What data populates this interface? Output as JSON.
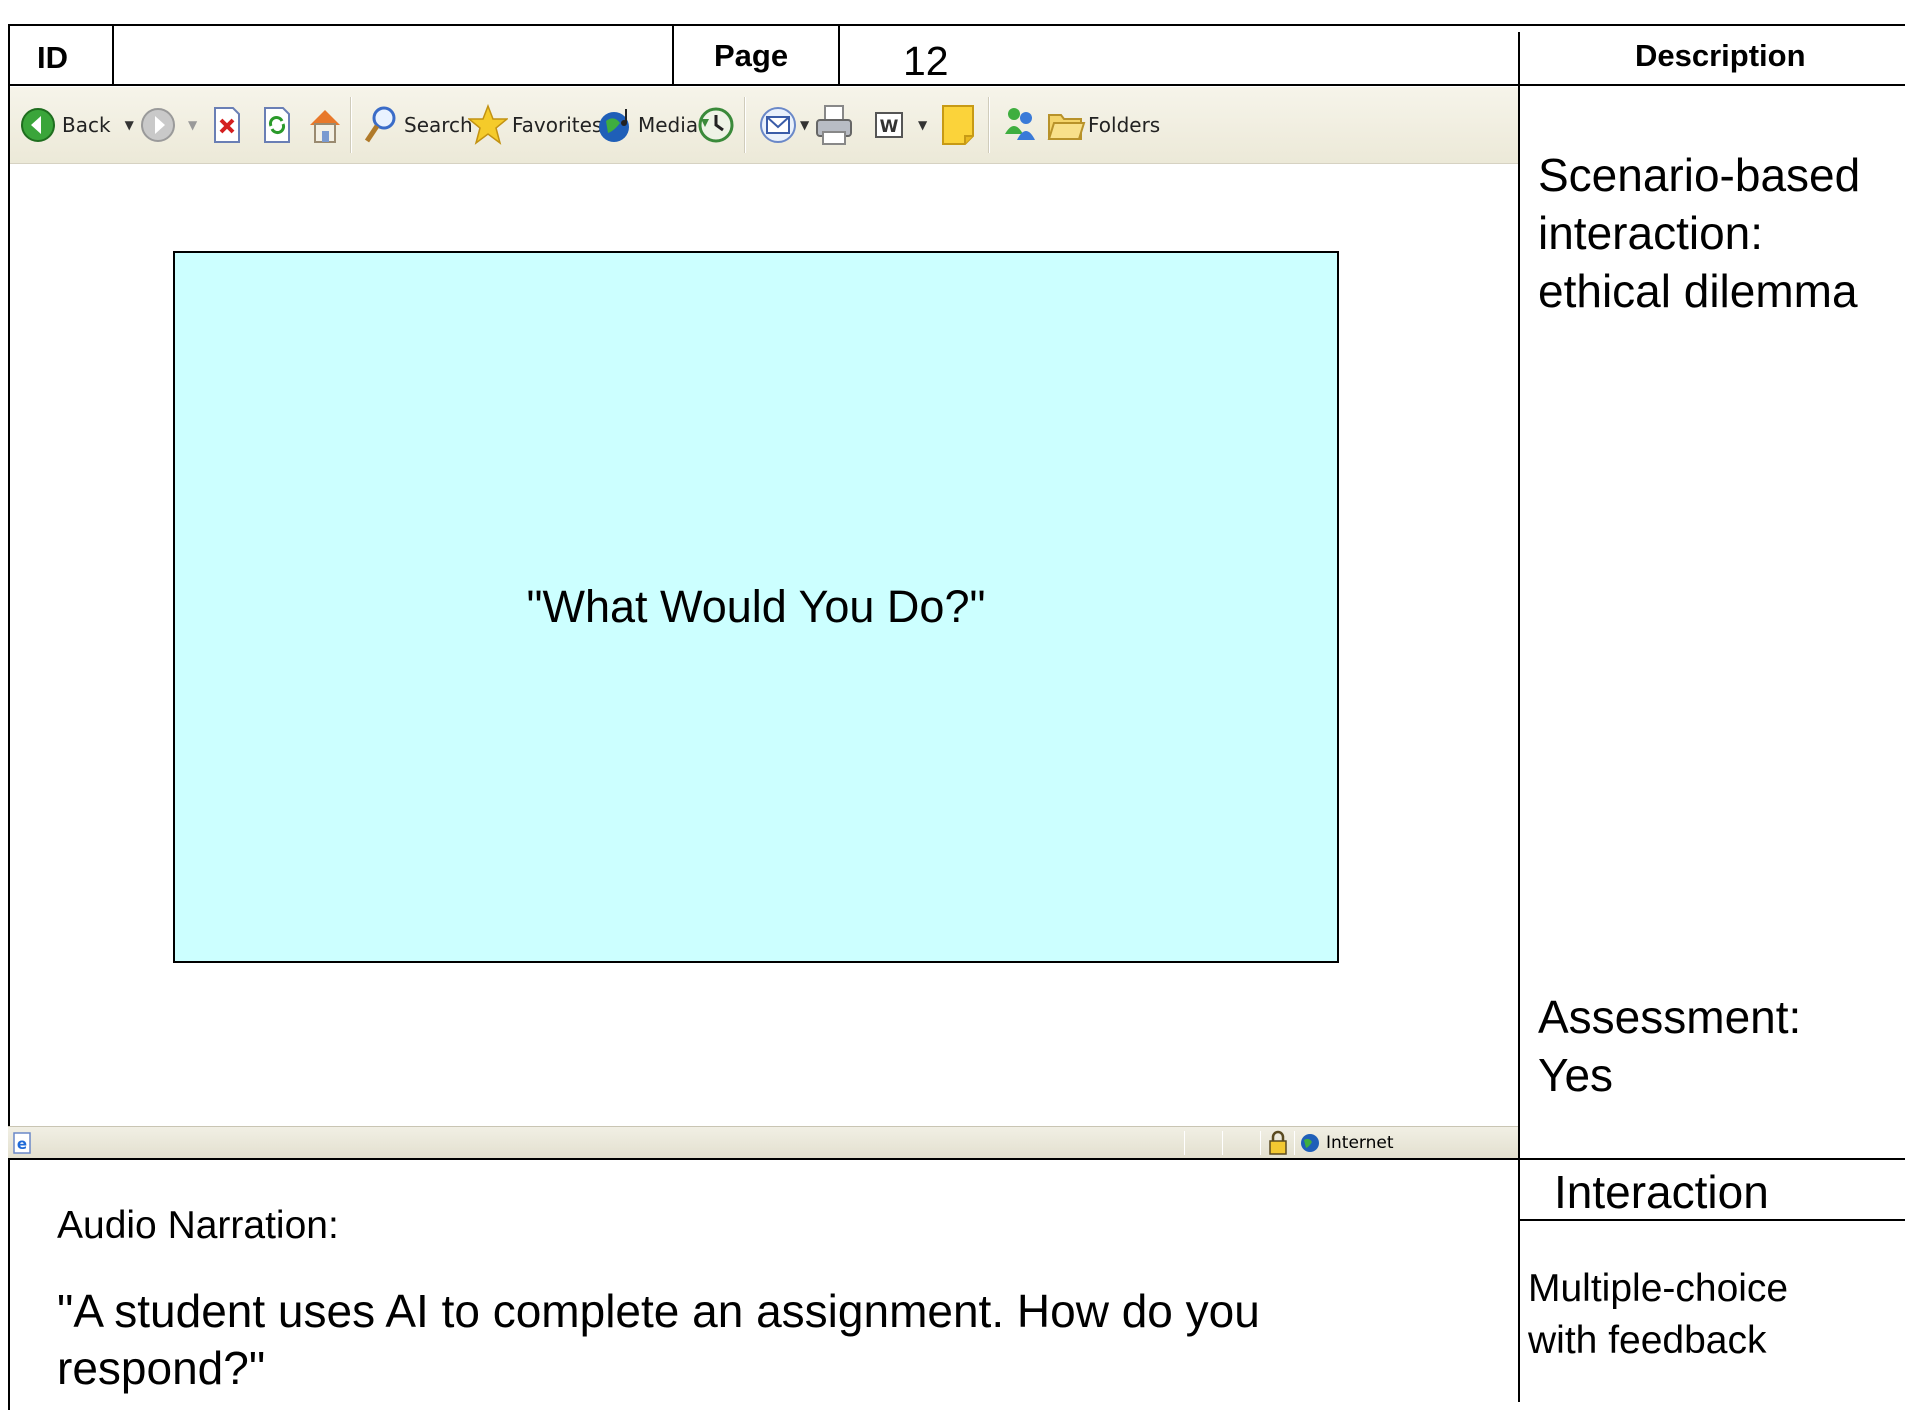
{
  "header": {
    "id_label": "ID",
    "id_value": "",
    "page_label": "Page",
    "page_number": "12",
    "description_label": "Description"
  },
  "browser": {
    "toolbar": {
      "back_label": "Back",
      "search_label": "Search",
      "favorites_label": "Favorites",
      "media_label": "Media",
      "folders_label": "Folders"
    },
    "statusbar": {
      "zone_label": "Internet"
    },
    "icons": [
      "back-icon",
      "forward-icon",
      "stop-icon",
      "refresh-icon",
      "home-icon",
      "search-icon",
      "favorites-icon",
      "media-icon",
      "history-icon",
      "mail-icon",
      "print-icon",
      "word-icon",
      "note-icon",
      "messenger-icon",
      "folders-icon",
      "ie-page-icon",
      "lock-icon",
      "globe-icon"
    ]
  },
  "content": {
    "scenario_text": "\"What Would You Do?\"",
    "scenario_box_color": "#ccffff"
  },
  "description": {
    "lines": [
      "Scenario-based",
      "interaction:",
      "ethical dilemma"
    ],
    "assessment_lines": [
      "Assessment:",
      "Yes"
    ]
  },
  "interaction": {
    "label": "Interaction",
    "lines": [
      "Multiple-choice",
      "with feedback"
    ]
  },
  "audio": {
    "label": "Audio Narration:",
    "lines": [
      "\"A student uses AI to complete an assignment. How do you",
      "respond?\""
    ]
  }
}
